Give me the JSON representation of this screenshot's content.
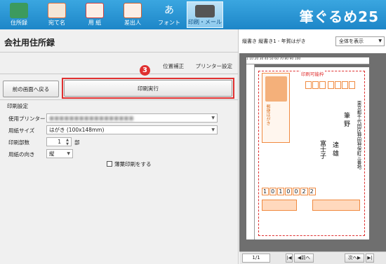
{
  "app": {
    "logo": "筆ぐるめ25"
  },
  "toolbar": {
    "items": [
      {
        "label": "住所録",
        "icon": "address-book-icon",
        "color": "#2e8b57"
      },
      {
        "label": "宛て名",
        "icon": "addressee-icon",
        "color": "#e07040"
      },
      {
        "label": "用 紙",
        "icon": "paper-icon",
        "color": "#d04040"
      },
      {
        "label": "差出人",
        "icon": "sender-icon",
        "color": "#d06030"
      },
      {
        "label": "フォント",
        "icon": "font-icon",
        "glyph": "あ"
      },
      {
        "label": "印刷・メール",
        "icon": "printer-icon",
        "active": true
      }
    ]
  },
  "left": {
    "title": "会社用住所録",
    "links": {
      "position": "位置補正",
      "printer": "プリンター設定"
    },
    "back_button": "前の画面へ戻る",
    "print_button": "印刷実行",
    "step_marker": "3",
    "section_label": "印刷設定",
    "fields": {
      "printer_label": "使用プリンター",
      "printer_value": "■■■■■■■■■■■■■■■■■",
      "paper_label": "用紙サイズ",
      "paper_value": "はがき (100x148mm)",
      "copies_label": "印刷部数",
      "copies_value": "1",
      "copies_unit": "部",
      "orientation_label": "用紙の向き",
      "orientation_value": "縦",
      "thin_paper_label": "薄葉印刷をする"
    }
  },
  "preview": {
    "title": "縦書き 縦書き1 - 年賀はがき",
    "zoom_value": "全体を表示",
    "print_area_label": "印刷可能枠",
    "ruler_numbers": "1 10 20 30 40 50 60 70 80 90 100",
    "recipient_address": "東京都千代田区神田神保町三番地",
    "recipient_name_1": "筆 野",
    "recipient_given_1": "達 雄",
    "recipient_name_2": "富士子",
    "sender_zip": [
      "1",
      "0",
      "1",
      "0",
      "0",
      "2",
      "2"
    ],
    "stamp_label": "郵便はがき",
    "page_indicator": "1/1",
    "prev_button": "前へ",
    "next_button": "次へ"
  }
}
